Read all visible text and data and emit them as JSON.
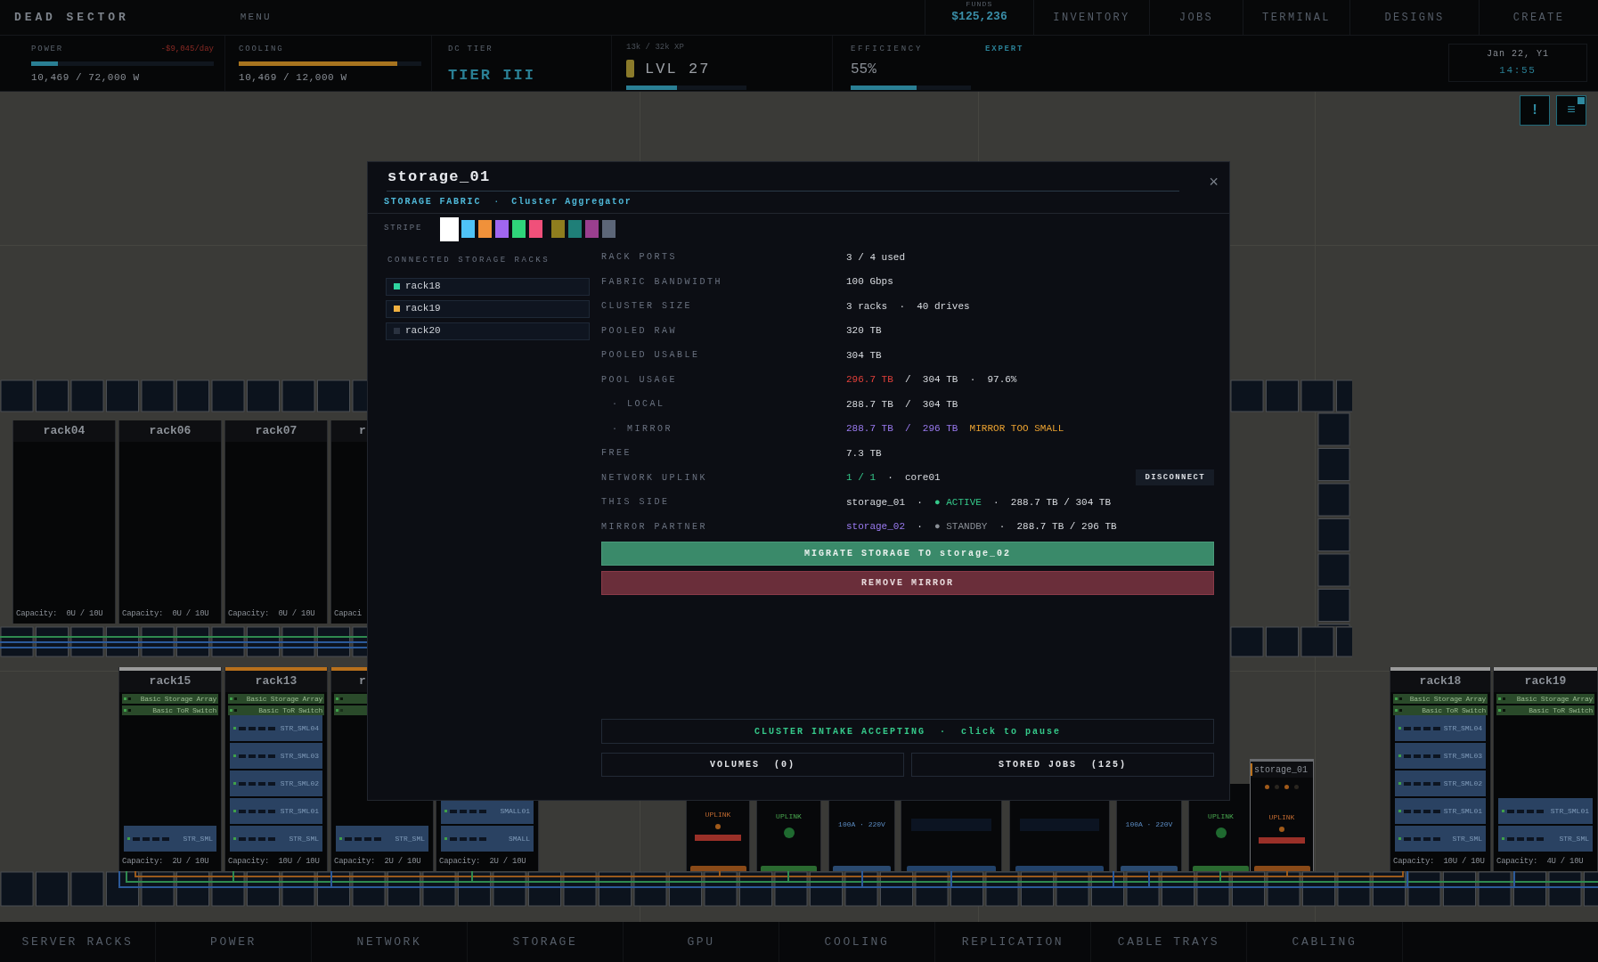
{
  "top_bar": {
    "brand": "DEAD SECTOR",
    "menu": "MENU",
    "funds_label": "FUNDS",
    "funds": "$125,236",
    "nav": [
      "INVENTORY",
      "JOBS",
      "TERMINAL",
      "DESIGNS",
      "CREATE"
    ]
  },
  "stats": {
    "power": {
      "label": "POWER",
      "cost": "-$9,045/day",
      "level": 0.145,
      "reading": "10,469 / 72,000 W"
    },
    "cooling": {
      "label": "COOLING",
      "level": 0.87,
      "reading": "10,469 / 12,000 W"
    },
    "tier": {
      "label": "DC TIER",
      "value": "TIER III"
    },
    "xp": {
      "label": "13k / 32k XP",
      "value": "LVL 27",
      "level": 0.42
    },
    "efficiency": {
      "label": "EFFICIENCY",
      "value": "55%",
      "level": 0.55,
      "rank": "EXPERT"
    },
    "clock": {
      "date": "Jan 22, Y1",
      "time": "14:55"
    }
  },
  "corner_buttons": [
    {
      "label": "!",
      "badge": false
    },
    {
      "label": "≡",
      "badge": true
    }
  ],
  "floor": {
    "upper_racks": [
      {
        "name": "rack04",
        "capacity": "Capacity:  0U / 10U"
      },
      {
        "name": "rack06",
        "capacity": "Capacity:  0U / 10U"
      },
      {
        "name": "rack07",
        "capacity": "Capacity:  0U / 10U"
      },
      {
        "name": "r",
        "capacity": "Capaci"
      }
    ],
    "lower_racks": [
      {
        "name": "rack15",
        "color": "#9a9a9a",
        "devices": [
          {
            "label": "Basic Storage Array"
          },
          {
            "label": "Basic ToR Switch"
          }
        ],
        "drives": [
          "STR_SML"
        ],
        "capacity": "Capacity:  2U / 10U"
      },
      {
        "name": "rack13",
        "color": "#b8701c",
        "devices": [
          {
            "label": "Basic Storage Array"
          },
          {
            "label": "Basic ToR Switch"
          }
        ],
        "drives": [
          "STR_SML04",
          "STR_SML03",
          "STR_SML02",
          "STR_SML01",
          "STR_SML"
        ],
        "capacity": "Capacity:  10U / 10U"
      },
      {
        "name": "r",
        "color": "#b8701c",
        "devices": [
          {
            "kind": "array"
          },
          {
            "kind": "switch"
          }
        ],
        "drives": [
          "STR_SML"
        ],
        "capacity": "Capacity:  2U / 10U"
      },
      {
        "drives": [
          "SMALL01",
          "SMALL"
        ],
        "capacity": "Capacity:  2U / 10U"
      }
    ],
    "equipment": [
      {
        "kind": "sas",
        "label": "UPLINK"
      },
      {
        "kind": "sfp",
        "label": "UPLINK"
      },
      {
        "kind": "pdu",
        "label": "100A · 220V"
      },
      {
        "kind": "ups"
      },
      {
        "kind": "ups"
      },
      {
        "kind": "pdu",
        "label": "100A · 220V"
      },
      {
        "kind": "sfp",
        "label": "UPLINK"
      }
    ],
    "storage_unit": {
      "name": "storage_01",
      "label": "UPLINK"
    },
    "right_racks": [
      {
        "name": "rack18",
        "color": "#9a9a9a",
        "devices": [
          {
            "label": "Basic Storage Array"
          },
          {
            "label": "Basic ToR Switch"
          }
        ],
        "drives": [
          "STR_SML04",
          "STR_SML03",
          "STR_SML02",
          "STR_SML01",
          "STR_SML"
        ],
        "capacity": "Capacity:  10U / 10U"
      },
      {
        "name": "rack19",
        "color": "#9a9a9a",
        "devices": [
          {
            "label": "Basic Storage Array"
          },
          {
            "label": "Basic ToR Switch"
          }
        ],
        "drives": [
          "STR_SML01",
          "STR_SML"
        ],
        "capacity": "Capacity:  4U / 10U"
      }
    ]
  },
  "modal": {
    "title": "storage_01",
    "category": "STORAGE FABRIC",
    "separator": "·",
    "subtitle": "Cluster Aggregator",
    "close": "×",
    "stripe": {
      "label": "STRIPE",
      "swatches": [
        {
          "color": "#ffffff",
          "selected": true
        },
        {
          "color": "#4fc3f7",
          "selected": false
        },
        {
          "color": "#f0913a",
          "selected": false
        },
        {
          "color": "#a066f0",
          "selected": false
        },
        {
          "color": "#2fd47a",
          "selected": false
        },
        {
          "color": "#f0507a",
          "selected": false
        },
        {
          "color": "#8f7d1e",
          "selected": false
        },
        {
          "color": "#1f7f78",
          "selected": false
        },
        {
          "color": "#9a3f8f",
          "selected": false
        },
        {
          "color": "#5c6678",
          "selected": false
        }
      ]
    },
    "racks_heading": "CONNECTED STORAGE RACKS",
    "racks": [
      {
        "name": "rack18",
        "color": "#2fd4a0"
      },
      {
        "name": "rack19",
        "color": "#f0b040"
      },
      {
        "name": "rack20",
        "color": "#2a3240"
      }
    ],
    "fields": [
      {
        "label": "RACK PORTS",
        "value": [
          {
            "text": "3 / 4 used",
            "kind": "plain"
          }
        ]
      },
      {
        "label": "FABRIC BANDWIDTH",
        "value": [
          {
            "text": "100 Gbps",
            "kind": "plain"
          }
        ]
      },
      {
        "label": "CLUSTER SIZE",
        "value": [
          {
            "text": "3 racks  ·  40 drives",
            "kind": "plain"
          }
        ]
      },
      {
        "label": "POOLED RAW",
        "value": [
          {
            "text": "320 TB",
            "kind": "plain"
          }
        ]
      },
      {
        "label": "POOLED USABLE",
        "value": [
          {
            "text": "304 TB",
            "kind": "plain"
          }
        ]
      },
      {
        "label": "POOL USAGE",
        "value": [
          {
            "text": "296.7 TB",
            "kind": "red"
          },
          {
            "text": "  /  304 TB  ·  97.6%",
            "kind": "plain"
          }
        ]
      },
      {
        "label": "· LOCAL",
        "value": [
          {
            "text": "288.7 TB  /  304 TB",
            "kind": "plain"
          }
        ]
      },
      {
        "label": "· MIRROR",
        "value": [
          {
            "text": "288.7 TB  /  296 TB",
            "kind": "purple"
          },
          {
            "text": "  MIRROR TOO SMALL",
            "kind": "orange"
          }
        ]
      },
      {
        "label": "FREE",
        "value": [
          {
            "text": "7.3 TB",
            "kind": "plain"
          }
        ]
      },
      {
        "label": "NETWORK UPLINK",
        "value": [
          {
            "text": "1 / 1",
            "kind": "green"
          },
          {
            "text": "  ·  core01",
            "kind": "plain"
          }
        ],
        "action": "DISCONNECT"
      },
      {
        "label": "THIS SIDE",
        "value": [
          {
            "text": "storage_01  ·  ",
            "kind": "plain"
          },
          {
            "text": "● ACTIVE",
            "kind": "green"
          },
          {
            "text": "  ·  288.7 TB / 304 TB",
            "kind": "plain"
          }
        ]
      },
      {
        "label": "MIRROR PARTNER",
        "value": [
          {
            "text": "storage_02",
            "kind": "purple"
          },
          {
            "text": "  ·  ",
            "kind": "plain"
          },
          {
            "text": "● STANDBY",
            "kind": "muted"
          },
          {
            "text": "  ·  288.7 TB / 296 TB",
            "kind": "plain"
          }
        ]
      }
    ],
    "actions": [
      {
        "label": "MIGRATE STORAGE TO storage_02",
        "kind": "confirm"
      },
      {
        "label": "REMOVE MIRROR",
        "kind": "danger"
      }
    ],
    "intake": "CLUSTER INTAKE ACCEPTING  ·  click to pause",
    "bottom_buttons": [
      "VOLUMES  (0)",
      "STORED JOBS  (125)"
    ]
  },
  "bottom_tabs": [
    "SERVER RACKS",
    "POWER",
    "NETWORK",
    "STORAGE",
    "GPU",
    "COOLING",
    "REPLICATION",
    "CABLE TRAYS",
    "CABLING"
  ]
}
